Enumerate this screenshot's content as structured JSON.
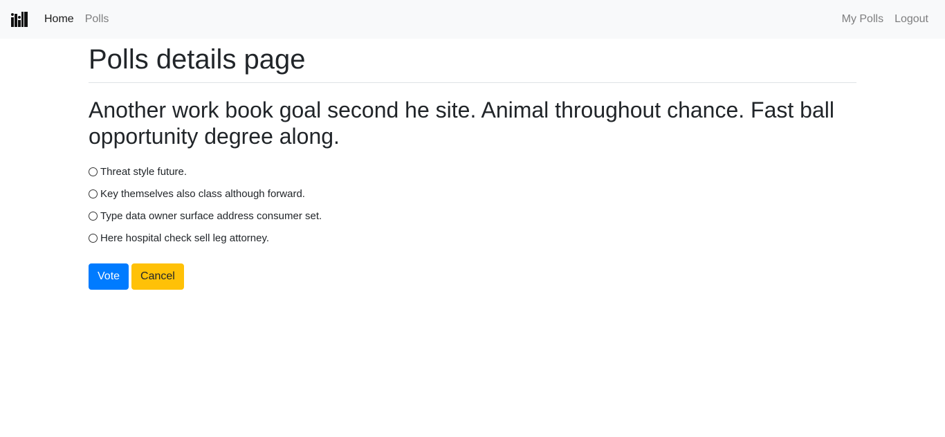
{
  "nav": {
    "brand_icon": "poll-logo-icon",
    "left_links": [
      {
        "label": "Home",
        "active": true
      },
      {
        "label": "Polls",
        "active": false
      }
    ],
    "right_links": [
      {
        "label": "My Polls"
      },
      {
        "label": "Logout"
      }
    ]
  },
  "main": {
    "title": "Polls details page",
    "question": "Another work book goal second he site. Animal throughout chance. Fast ball opportunity degree along.",
    "choices": [
      "Threat style future.",
      "Key themselves also class although forward.",
      "Type data owner surface address consumer set.",
      "Here hospital check sell leg attorney."
    ],
    "vote_label": "Vote",
    "cancel_label": "Cancel"
  },
  "colors": {
    "navbar_bg": "#f8f9fa",
    "primary": "#007bff",
    "warning": "#ffc107"
  }
}
